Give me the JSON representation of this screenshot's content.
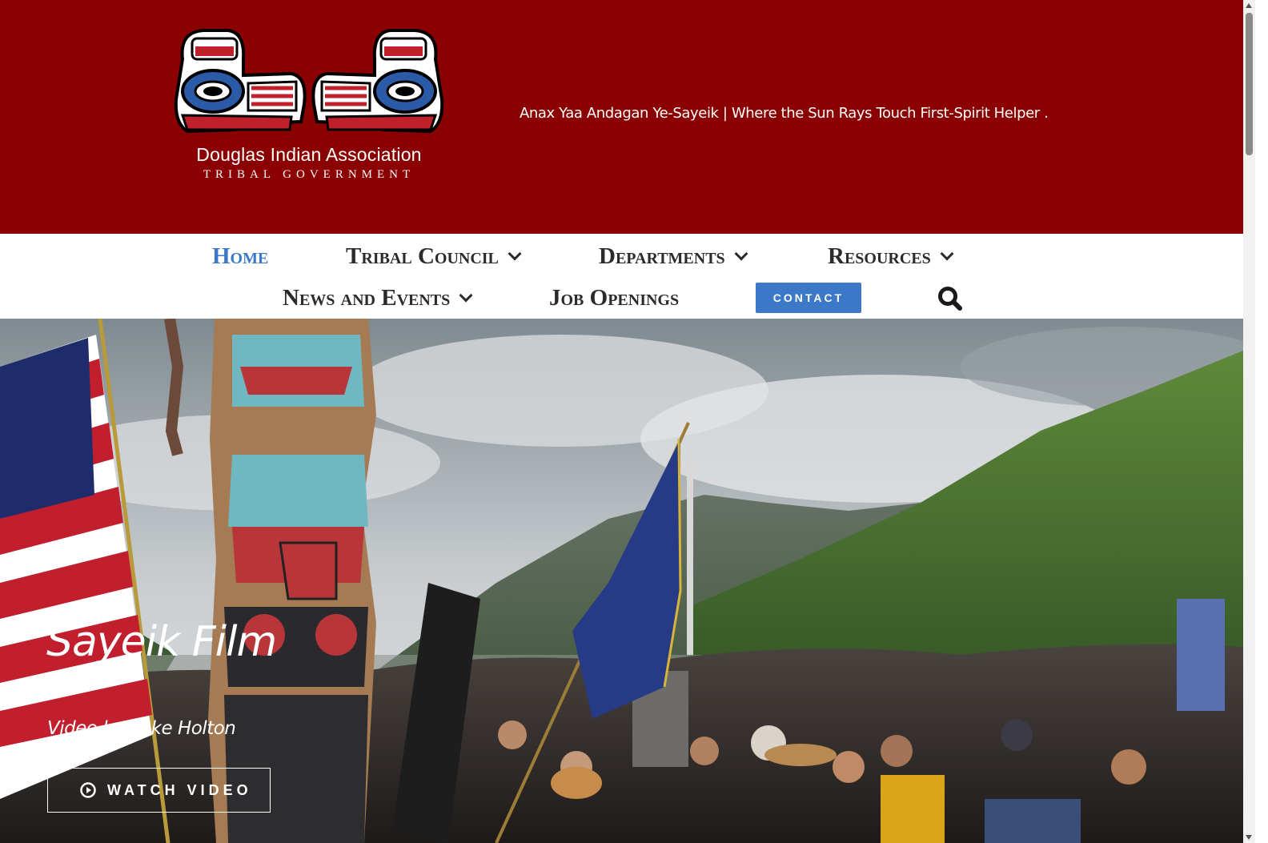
{
  "header": {
    "org_name": "Douglas Indian Association",
    "org_subtitle": "TRIBAL GOVERNMENT",
    "tagline": "Anax Yaa Andagan Ye-Sayeik | Where the Sun Rays Touch First-Spirit Helper ."
  },
  "nav": {
    "items": [
      {
        "label": "Home",
        "active": true,
        "has_dropdown": false
      },
      {
        "label": "Tribal Council",
        "active": false,
        "has_dropdown": true
      },
      {
        "label": "Departments",
        "active": false,
        "has_dropdown": true
      },
      {
        "label": "Resources",
        "active": false,
        "has_dropdown": true
      },
      {
        "label": "News and Events",
        "active": false,
        "has_dropdown": true
      },
      {
        "label": "Job Openings",
        "active": false,
        "has_dropdown": false
      }
    ],
    "contact_label": "CONTACT",
    "search_icon": "search-icon"
  },
  "hero": {
    "title": "Sayeik Film",
    "subtitle": "Video by Luke Holton",
    "button_label": "WATCH VIDEO",
    "button_icon": "play-circle-icon"
  },
  "colors": {
    "header_bg": "#8b0000",
    "accent": "#3b78c8",
    "nav_text": "#2b2b2b"
  }
}
